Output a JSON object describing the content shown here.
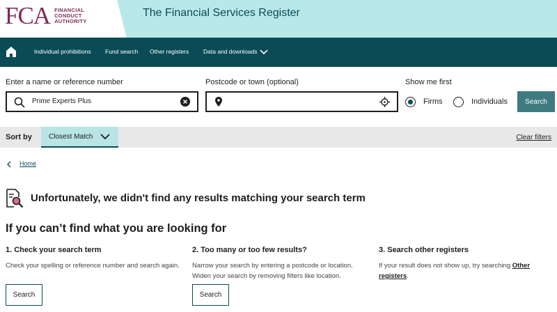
{
  "header": {
    "logo_mark": "FCA",
    "logo_lines": [
      "FINANCIAL",
      "CONDUCT",
      "AUTHORITY"
    ],
    "title": "The Financial Services Register",
    "colors": {
      "brand": "#7e2b57",
      "accent_band": "#b9e8e8",
      "nav_bg": "#0a4b55"
    }
  },
  "nav": {
    "items": [
      "Individual prohibitions",
      "Fund search",
      "Other registers",
      "Data and downloads"
    ]
  },
  "search": {
    "name_label": "Enter a name or reference number",
    "name_value": "Prime Experts Plus",
    "postcode_label": "Postcode or town (optional)",
    "postcode_value": "",
    "show_first_label": "Show me first",
    "options": [
      "Firms",
      "Individuals"
    ],
    "selected": "Firms",
    "button": "Search"
  },
  "sort": {
    "label": "Sort by",
    "value": "Closest Match",
    "clear": "Clear filters"
  },
  "breadcrumb": {
    "home": "Home"
  },
  "results": {
    "no_results": "Unfortunately, we didn't find any results matching your search term",
    "help_title": "If you can’t find what you are looking for",
    "columns": [
      {
        "title": "1. Check your search term",
        "text": "Check your spelling or reference number and search again.",
        "button": "Search"
      },
      {
        "title": "2. Too many or too few results?",
        "text": "Narrow your search by entering a postcode or location. Widen your search by removing filters like location.",
        "button": "Search"
      },
      {
        "title": "3. Search other registers",
        "text_before": "If your result does not show up, try searching ",
        "link": "Other registers",
        "text_after": "."
      }
    ]
  }
}
